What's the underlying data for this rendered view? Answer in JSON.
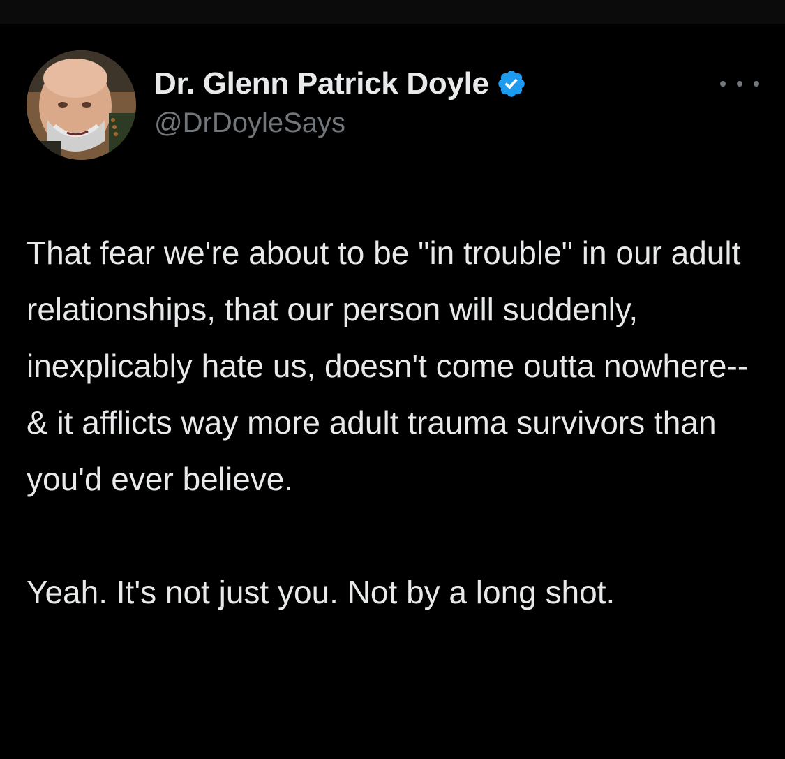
{
  "author": {
    "display_name": "Dr. Glenn Patrick Doyle",
    "handle": "@DrDoyleSays",
    "verified": true,
    "verified_color": "#1d9bf0",
    "avatar_icon": "profile-photo"
  },
  "tweet": {
    "paragraphs": [
      "That fear we're about to be \"in trouble\" in our adult relationships, that our person will suddenly, inexplicably hate us, doesn't come outta nowhere-- & it afflicts way more adult trauma survivors than you'd ever believe.",
      "Yeah. It's not just you. Not by a long shot."
    ]
  },
  "menu": {
    "icon": "more-horizontal-icon"
  },
  "theme": {
    "background": "#000000",
    "text": "#e7e9ea",
    "secondary_text": "#71767b"
  }
}
